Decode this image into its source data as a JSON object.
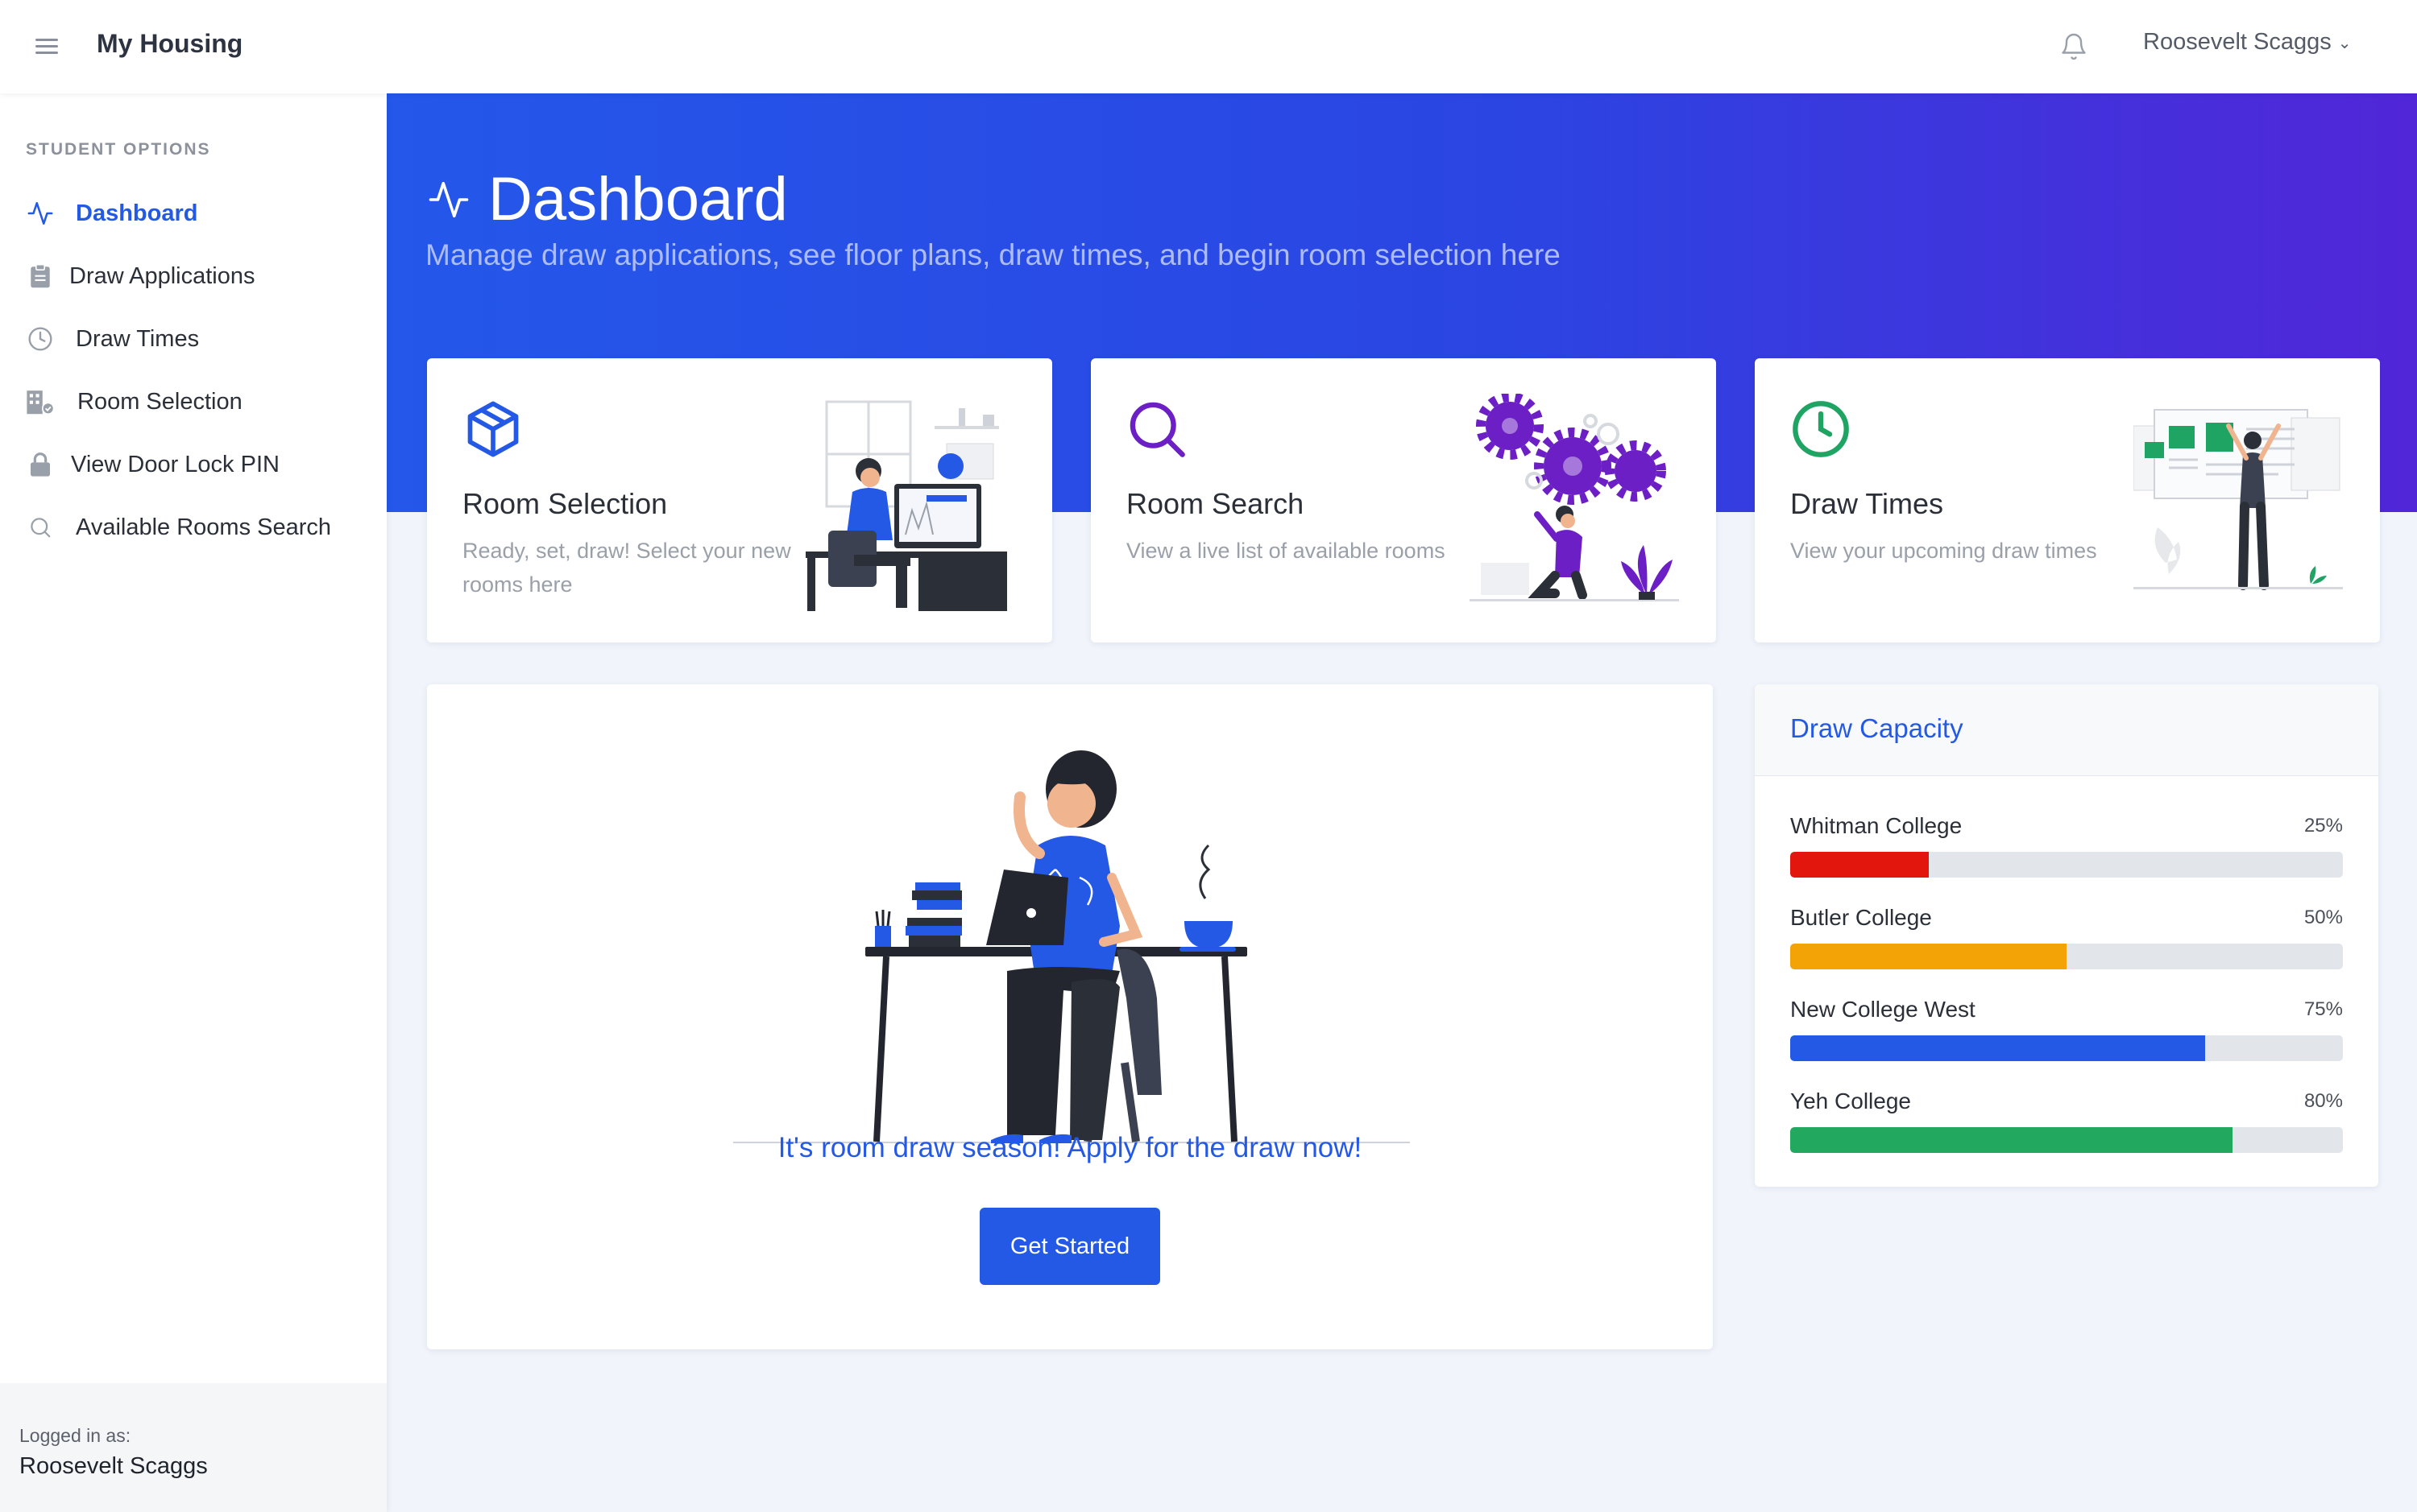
{
  "app": {
    "title": "My Housing"
  },
  "header": {
    "user_name": "Roosevelt Scaggs"
  },
  "sidebar": {
    "heading": "STUDENT OPTIONS",
    "items": [
      {
        "label": "Dashboard",
        "icon": "activity-icon",
        "active": true
      },
      {
        "label": "Draw Applications",
        "icon": "clipboard-icon"
      },
      {
        "label": "Draw Times",
        "icon": "clock-icon"
      },
      {
        "label": "Room Selection",
        "icon": "building-icon"
      },
      {
        "label": "View Door Lock PIN",
        "icon": "lock-icon"
      },
      {
        "label": "Available Rooms Search",
        "icon": "search-icon"
      }
    ],
    "footer": {
      "label": "Logged in as:",
      "name": "Roosevelt Scaggs"
    }
  },
  "hero": {
    "title": "Dashboard",
    "subtitle": "Manage draw applications, see floor plans, draw times, and begin room selection here"
  },
  "cards": [
    {
      "title": "Room Selection",
      "description": "Ready, set, draw! Select your new rooms here",
      "icon": "cube-icon",
      "accent": "#2459e6"
    },
    {
      "title": "Room Search",
      "description": "View a live list of available rooms",
      "icon": "search-icon",
      "accent": "#6b1fc4"
    },
    {
      "title": "Draw Times",
      "description": "View your upcoming draw times",
      "icon": "clock-icon",
      "accent": "#1fa463"
    }
  ],
  "main": {
    "message": "It's room draw season! Apply for the draw now!",
    "button_label": "Get Started"
  },
  "capacity": {
    "title": "Draw Capacity",
    "rows": [
      {
        "name": "Whitman College",
        "percent_label": "25%",
        "percent": 25,
        "color": "#e3160e"
      },
      {
        "name": "Butler College",
        "percent_label": "50%",
        "percent": 50,
        "color": "#f3a306"
      },
      {
        "name": "New College West",
        "percent_label": "75%",
        "percent": 75,
        "color": "#2459e6"
      },
      {
        "name": "Yeh College",
        "percent_label": "80%",
        "percent": 80,
        "color": "#23a860"
      }
    ]
  },
  "colors": {
    "primary": "#2459e6",
    "hero_start": "#2457ea",
    "hero_end": "#5126d8"
  }
}
